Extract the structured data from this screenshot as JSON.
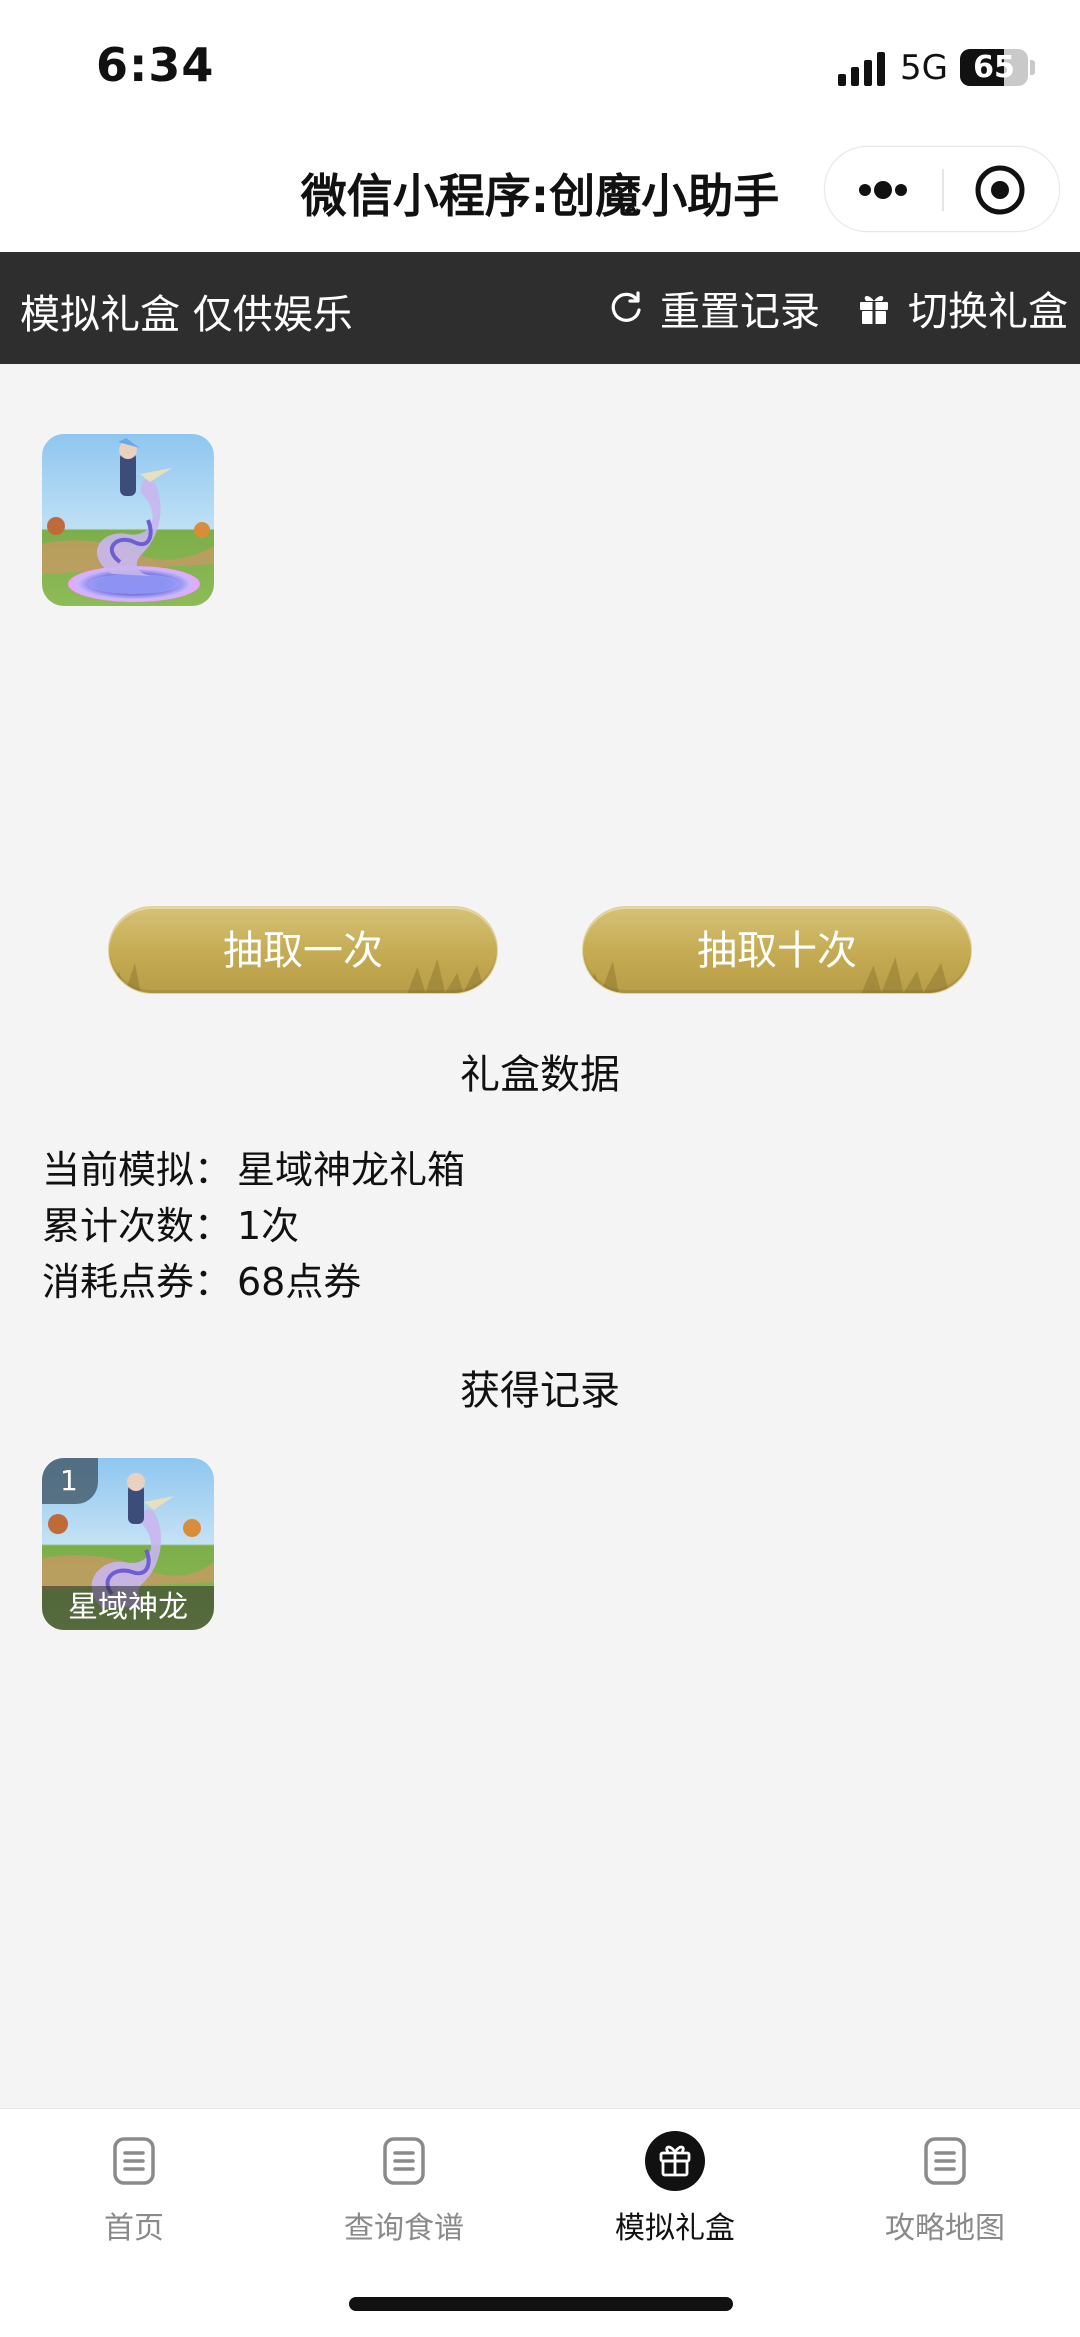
{
  "status_bar": {
    "time": "6:34",
    "network": "5G",
    "battery": "65",
    "battery_level_percent": 65
  },
  "nav": {
    "title": "微信小程序:创魔小助手"
  },
  "toolbar": {
    "title": "模拟礼盒 仅供娱乐",
    "reset_label": "重置记录",
    "switch_label": "切换礼盒"
  },
  "actions": {
    "draw_once": "抽取一次",
    "draw_ten": "抽取十次"
  },
  "stats": {
    "section_title": "礼盒数据",
    "rows": [
      {
        "label": "当前模拟：",
        "value": "星域神龙礼箱"
      },
      {
        "label": "累计次数：",
        "value": "1次"
      },
      {
        "label": "消耗点券：",
        "value": "68点券"
      }
    ]
  },
  "records": {
    "section_title": "获得记录",
    "items": [
      {
        "count": "1",
        "name": "星域神龙"
      }
    ]
  },
  "tabs": [
    {
      "label": "首页",
      "icon": "document-icon"
    },
    {
      "label": "查询食谱",
      "icon": "document-icon"
    },
    {
      "label": "模拟礼盒",
      "icon": "gift-icon",
      "active": true
    },
    {
      "label": "攻略地图",
      "icon": "document-icon"
    }
  ],
  "colors": {
    "toolbar_bg": "#2e2e2e",
    "button_gold": "#c4aa52",
    "page_bg": "#f4f4f4"
  }
}
